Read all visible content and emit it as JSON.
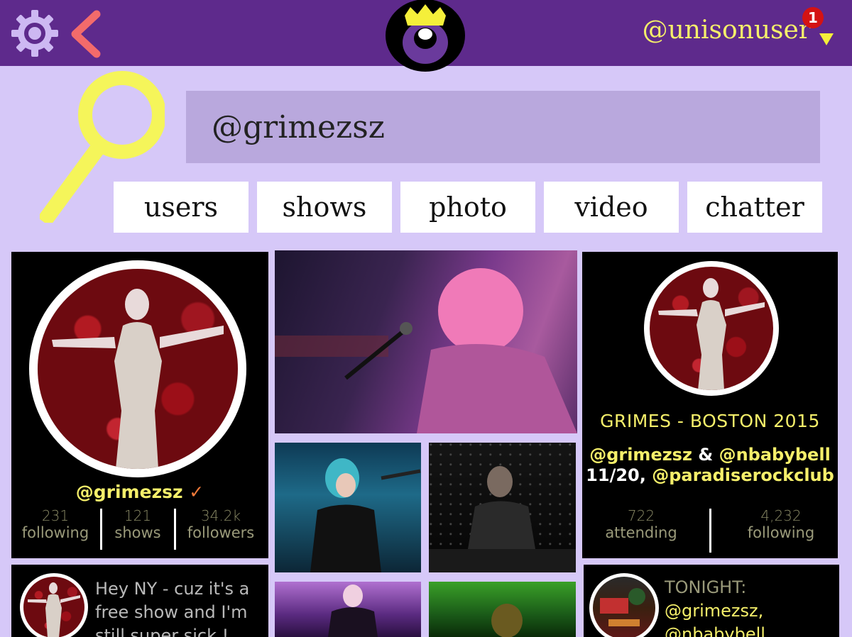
{
  "header": {
    "username": "@unisonuser",
    "notification_count": "1"
  },
  "search": {
    "query": "@grimezsz"
  },
  "tabs": [
    {
      "label": "users"
    },
    {
      "label": "shows"
    },
    {
      "label": "photo"
    },
    {
      "label": "video"
    },
    {
      "label": "chatter"
    }
  ],
  "profile_card": {
    "handle": "@grimezsz",
    "verified_mark": "✓",
    "stats": [
      {
        "value": "231",
        "label": "following"
      },
      {
        "value": "121",
        "label": "shows"
      },
      {
        "value": "34.2k",
        "label": "followers"
      }
    ]
  },
  "event_card": {
    "title": "GRIMES - BOSTON 2015",
    "line1_handle_a": "@grimezsz",
    "line1_amp": "&",
    "line1_handle_b": "@nbabybell",
    "line2_date": "11/20,",
    "line2_venue": "@paradiserockclub",
    "stats": [
      {
        "value": "722",
        "label": "attending"
      },
      {
        "value": "4,232",
        "label": "following"
      }
    ]
  },
  "post_card_left": {
    "lines": [
      "Hey NY - cuz it's a",
      "free show and I'm",
      "still super sick !"
    ]
  },
  "post_card_right": {
    "lines": [
      "TONIGHT:",
      "@grimezsz,",
      "@nbabybell"
    ]
  },
  "colors": {
    "topbar": "#5e2a8c",
    "background": "#d6c8f8",
    "accent_yellow": "#f5ef6a",
    "search_box": "#b9a8dd",
    "back_arrow": "#f36b6b",
    "notification": "#d41313"
  },
  "icons": {
    "settings": "gear-icon",
    "back": "chevron-left-icon",
    "logo": "crown-logo",
    "search": "magnifier-icon",
    "dropdown": "caret-down-icon"
  }
}
